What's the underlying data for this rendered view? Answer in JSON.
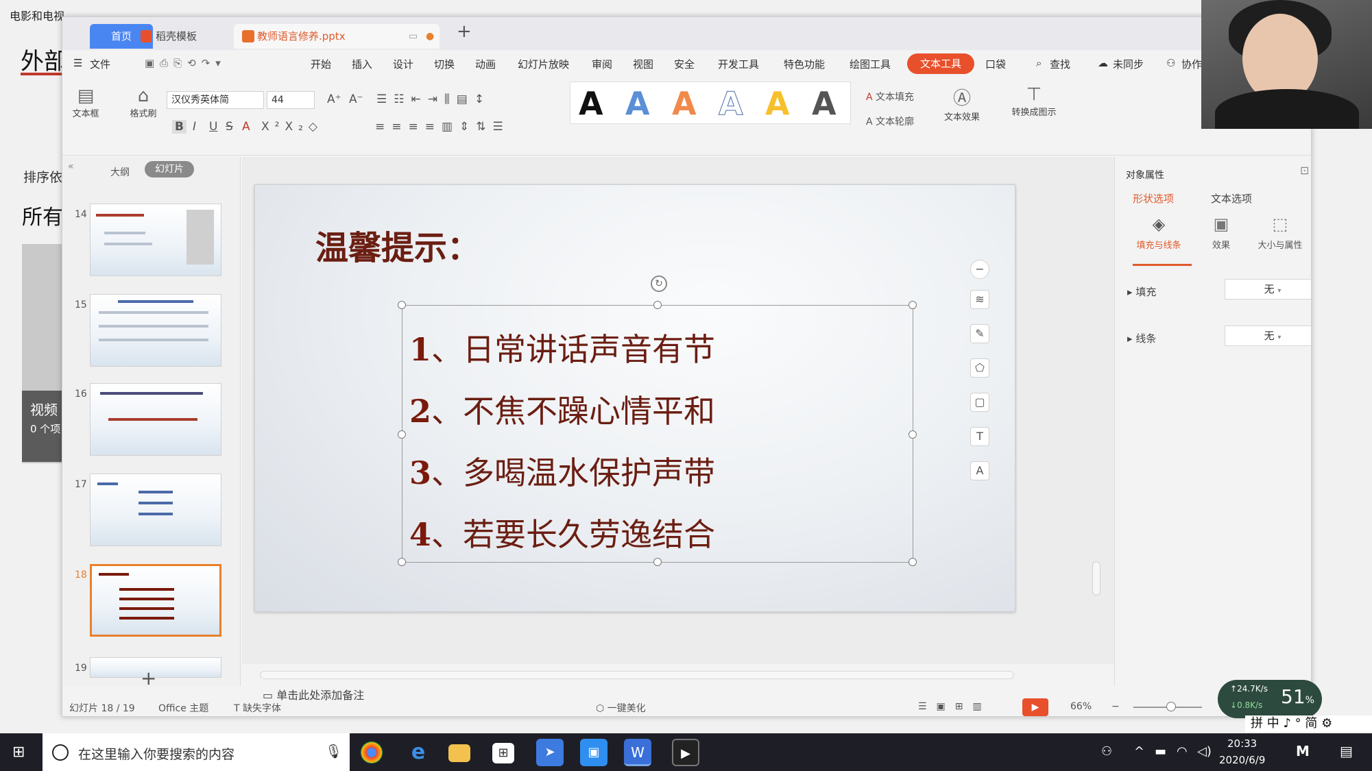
{
  "background_app": {
    "title": "电影和电视",
    "heading": "外部",
    "sort_label": "排序依",
    "all_label": "所有",
    "video_label": "视频",
    "video_count": "0 个项"
  },
  "tabs": {
    "home": "首页",
    "template": "稻壳模板",
    "document": "教师语言修养.pptx",
    "add": "+"
  },
  "menu": {
    "file": "文件",
    "items": [
      "开始",
      "插入",
      "设计",
      "切换",
      "动画",
      "幻灯片放映",
      "审阅",
      "视图",
      "安全",
      "开发工具",
      "特色功能",
      "绘图工具"
    ],
    "text_tool": "文本工具",
    "more": "口袋",
    "find": "查找",
    "sync": "未同步",
    "collab": "协作"
  },
  "toolbar": {
    "textbox": "文本框",
    "format_painter": "格式刷",
    "font_name": "汉仪秀英体简",
    "font_size": "44",
    "text_fill": "文本填充",
    "text_outline": "文本轮廓",
    "text_effect": "文本效果",
    "convert_smartart": "转换成图示",
    "style_letter": "A"
  },
  "left_panel": {
    "outline_tab": "大纲",
    "slides_tab": "幻灯片",
    "slide_numbers": [
      "14",
      "15",
      "16",
      "17",
      "18",
      "19"
    ],
    "active_slide": "18",
    "add": "+"
  },
  "slide": {
    "title": "温馨提示：",
    "items": [
      {
        "num": "1",
        "text": "、日常讲话声音有节"
      },
      {
        "num": "2",
        "text": "、不焦不躁心情平和"
      },
      {
        "num": "3",
        "text": "、多喝温水保护声带"
      },
      {
        "num": "4",
        "text": "、若要长久劳逸结合"
      }
    ]
  },
  "notes_placeholder": "单击此处添加备注",
  "right_panel": {
    "title": "对象属性",
    "tab_shape": "形状选项",
    "tab_text": "文本选项",
    "fill_line": "填充与线条",
    "effects": "效果",
    "size_props": "大小与属性",
    "fill_label": "填充",
    "fill_value": "无",
    "line_label": "线条",
    "line_value": "无"
  },
  "status": {
    "slide_pos": "幻灯片 18 / 19",
    "theme": "Office 主题",
    "missing_font": "缺失字体",
    "beautify": "一键美化",
    "zoom": "66%",
    "zoom_level_percent": 66
  },
  "net_widget": {
    "up": "24.7K/s",
    "down": "0.8K/s",
    "percent": "51",
    "percent_unit": "%"
  },
  "ime": "拼 中 ♪ ° 简 ⚙",
  "taskbar": {
    "search_placeholder": "在这里输入你要搜索的内容",
    "time": "20:33",
    "date": "2020/6/9"
  },
  "colors": {
    "accent_orange": "#e8502c",
    "tab_blue": "#4a86f2",
    "slide_text": "#6b1e12"
  }
}
